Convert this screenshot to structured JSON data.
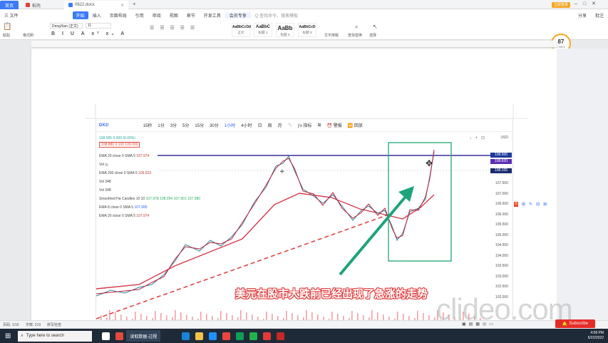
{
  "titlebar": {
    "home_tab": "首页",
    "tabs": [
      "稻壳",
      "0622.docx"
    ],
    "login": "立即登录"
  },
  "menubar": {
    "items": [
      "三 文件",
      "开始",
      "插入",
      "页面布局",
      "引用",
      "审阅",
      "视图",
      "章节",
      "开发工具",
      "会员专享",
      "Q 查找命令、搜索模板"
    ],
    "active_index": 1,
    "right_items": [
      "分享",
      "批注"
    ]
  },
  "toolbar": {
    "font_name": "DengXian (正文)",
    "font_size": "11",
    "styles": [
      {
        "sample": "AaBbCcDd",
        "name": "正文"
      },
      {
        "sample": "AaBbC",
        "name": "标题 1"
      },
      {
        "sample": "AaBb",
        "name": "标题 2"
      },
      {
        "sample": "AaBbCcD",
        "name": "标题 3"
      }
    ],
    "text_tools": "文字排版",
    "find_replace": "查找替换",
    "select": "选择",
    "paste": "粘贴",
    "format_painter": "格式刷"
  },
  "speed_widget": {
    "value": "87",
    "unit": "0.6K/s"
  },
  "chart_toolbar": {
    "symbol": "DX1!",
    "timeframes": [
      "15秒",
      "1分",
      "3分",
      "5分",
      "15分",
      "30分",
      "1小时",
      "4小时",
      "日",
      "周",
      "月"
    ],
    "active_timeframe": "1小时",
    "indicators_label": "指标",
    "alert_label": "警报",
    "replay_label": "回放",
    "currency": "USD"
  },
  "chart_indicators": [
    {
      "label": "108.005  0.000 (0.00%)",
      "value": ""
    },
    {
      "label": "108.880   0.100   109.000",
      "value": ""
    },
    {
      "label": "EMA 20 close 0 SMA 5",
      "value": "107.974"
    },
    {
      "label": "Vol",
      "value": ""
    },
    {
      "label": "EMA 200 close 0 SMA 5",
      "value": "106.523"
    },
    {
      "label": "Vol",
      "value": "348"
    },
    {
      "label": "Vol",
      "value": "348"
    },
    {
      "label": "Smoothed Ha Candles 10 10",
      "value": "107.978  108.054  107.901  107.980"
    },
    {
      "label": "EMA 8 close 0 SMA 5",
      "value": "107.995"
    },
    {
      "label": "EMA 20 close 0 SMA 5",
      "value": "107.974"
    }
  ],
  "price_tags": [
    {
      "value": "108.900",
      "color": "#1e3a9a"
    },
    {
      "value": "108.820",
      "color": "#5b2fb5"
    },
    {
      "value": "108.105",
      "color": "#1a2b6e"
    }
  ],
  "y_axis_labels": [
    "107.500",
    "107.000",
    "106.500",
    "106.000",
    "105.500",
    "105.000",
    "104.500",
    "104.000",
    "103.500",
    "103.000",
    "102.500",
    "102.000"
  ],
  "caption": "美元在股市大跌前已经出现了急涨的走势",
  "watermark": "clideo.com",
  "subscribe": "Subscribe",
  "statusbar": {
    "page": "页码: 1/16",
    "words": "字数: 219",
    "spell": "拼写检查"
  },
  "taskbar": {
    "search_placeholder": "Type here to search",
    "app_label": "读取数据-过程",
    "time": "4:58 PM",
    "date": "6/22/2022"
  }
}
